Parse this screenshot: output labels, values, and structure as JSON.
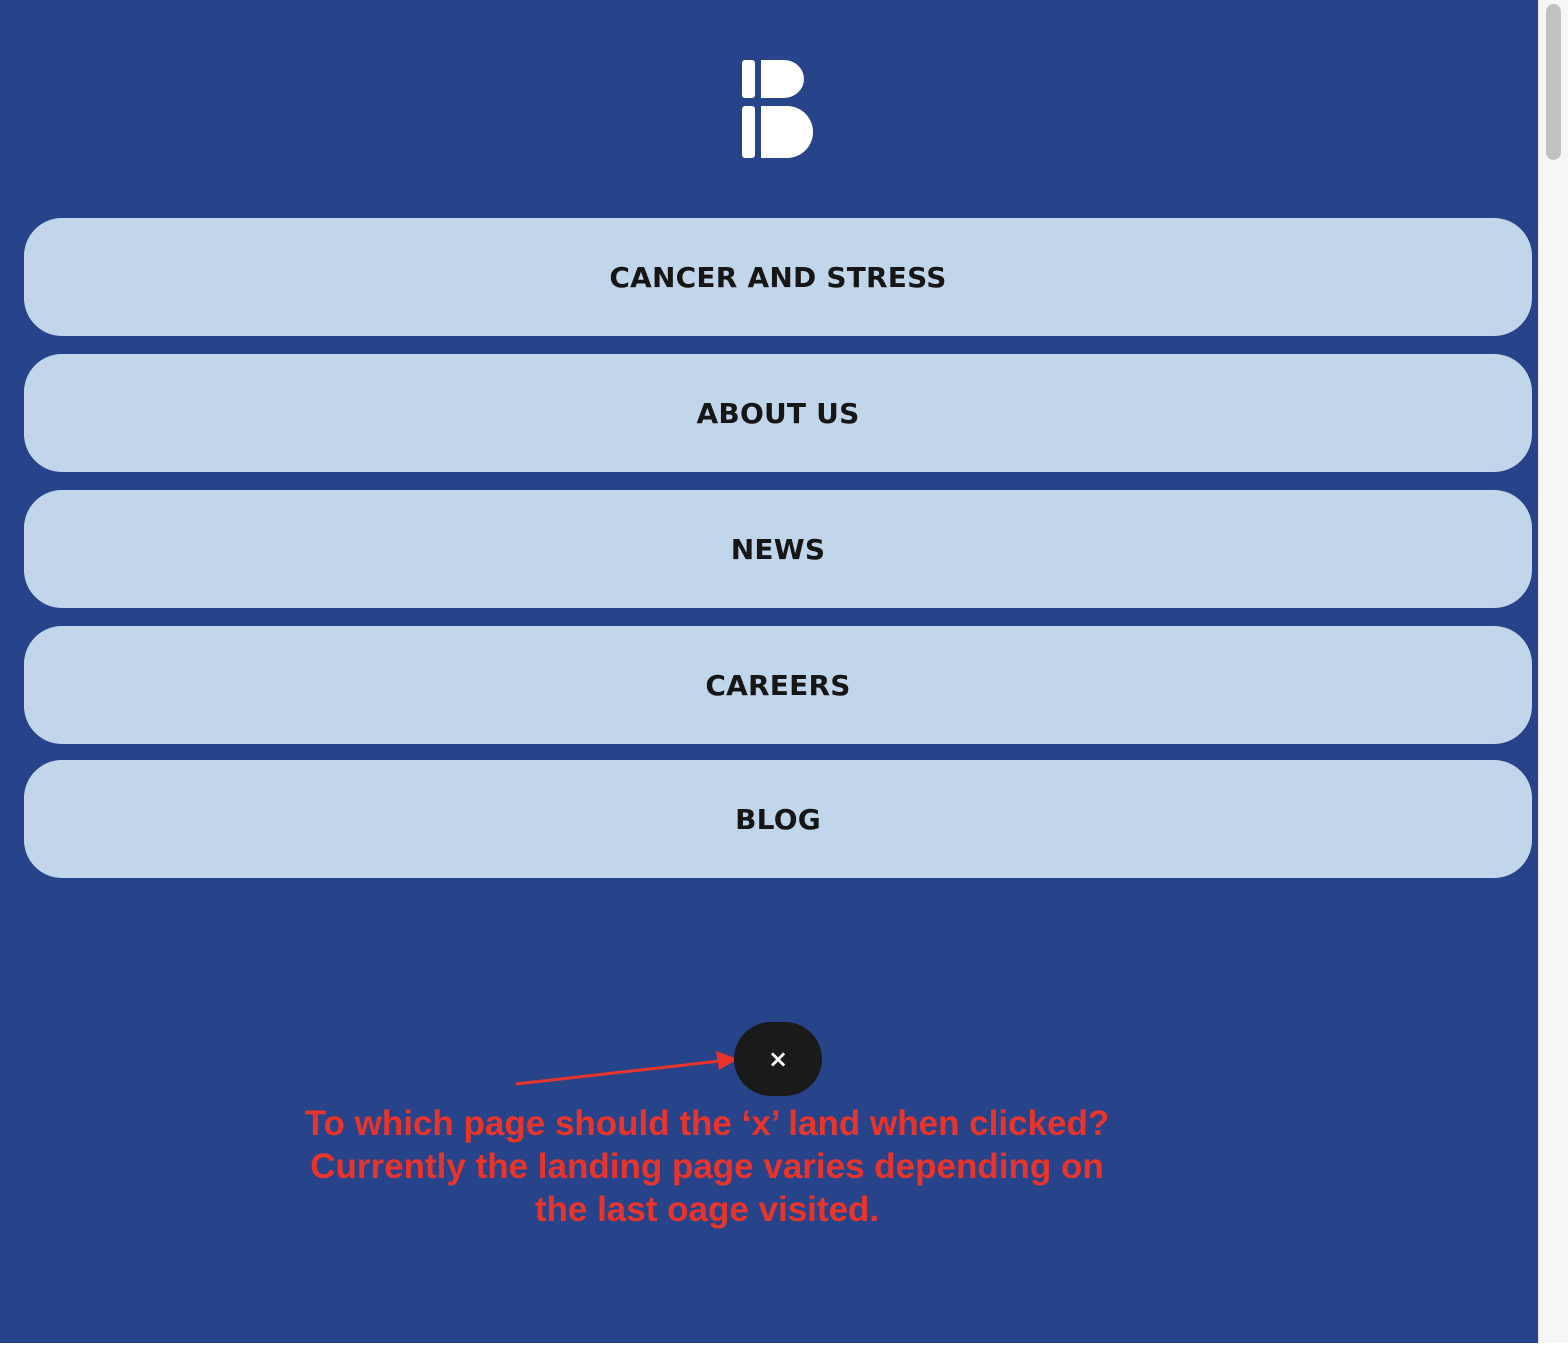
{
  "menu": {
    "background_color": "#27438a",
    "button_color": "#c2d6eb",
    "items": [
      {
        "label": "CANCER AND STRESS"
      },
      {
        "label": "ABOUT US"
      },
      {
        "label": "NEWS"
      },
      {
        "label": "CAREERS"
      },
      {
        "label": "BLOG"
      }
    ]
  },
  "logo": {
    "icon": "brand-b-logo-icon",
    "color": "#ffffff"
  },
  "close_button": {
    "glyph": "×",
    "icon": "close-icon",
    "color": "#1a1a1a"
  },
  "annotation": {
    "color": "#e9342b",
    "lines": [
      "To which page should the ‘x’ land when clicked?",
      "Currently the landing page varies depending on",
      "the last oage visited."
    ]
  }
}
